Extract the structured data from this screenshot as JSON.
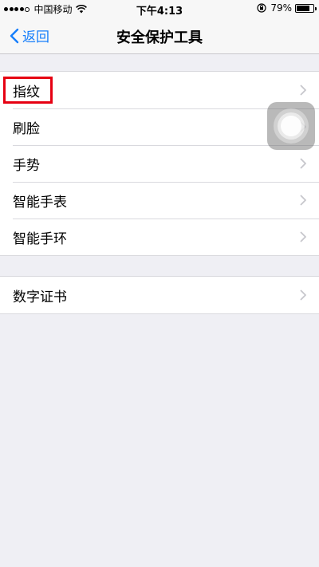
{
  "status_bar": {
    "carrier": "中国移动",
    "time": "下午4:13",
    "battery": "79%",
    "battery_level": 0.79
  },
  "nav": {
    "back_label": "返回",
    "title": "安全保护工具"
  },
  "groups": [
    {
      "items": [
        "指纹",
        "刷脸",
        "手势",
        "智能手表",
        "智能手环"
      ]
    },
    {
      "items": [
        "数字证书"
      ]
    }
  ],
  "highlighted_item": "指纹",
  "colors": {
    "accent": "#157efb",
    "highlight": "#e60012",
    "background": "#efeff4"
  }
}
